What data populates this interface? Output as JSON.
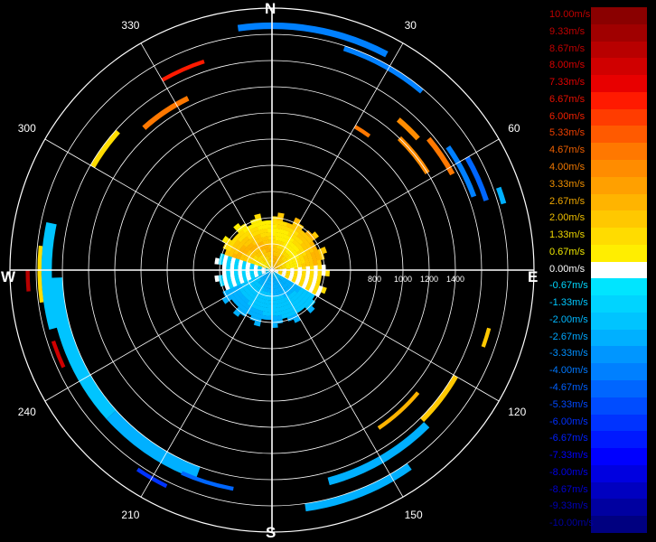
{
  "compass": {
    "north": "N",
    "east": "E",
    "south": "S",
    "west": "W"
  },
  "colors": {
    "background": "#000000",
    "grid": "#ffffff",
    "zero": "#ffffff"
  },
  "chart_data": {
    "type": "polar-radar",
    "angle_tick_labels": [
      {
        "angle": 30,
        "label": "30"
      },
      {
        "angle": 60,
        "label": "60"
      },
      {
        "angle": 120,
        "label": "120"
      },
      {
        "angle": 150,
        "label": "150"
      },
      {
        "angle": 210,
        "label": "210"
      },
      {
        "angle": 240,
        "label": "240"
      },
      {
        "angle": 300,
        "label": "300"
      },
      {
        "angle": 330,
        "label": "330"
      }
    ],
    "range_tick_labels": [
      {
        "value": 800,
        "label": "800"
      },
      {
        "value": 1000,
        "label": "1000"
      },
      {
        "value": 1200,
        "label": "1200"
      },
      {
        "value": 1400,
        "label": "1400"
      }
    ],
    "range_rings": [
      200,
      400,
      600,
      800,
      1000,
      1200,
      1400,
      1600,
      1800,
      2000
    ],
    "range_max": 2000,
    "legend_labels": [
      "10.00m/s",
      "9.33m/s",
      "8.67m/s",
      "8.00m/s",
      "7.33m/s",
      "6.67m/s",
      "6.00m/s",
      "5.33m/s",
      "4.67m/s",
      "4.00m/s",
      "3.33m/s",
      "2.67m/s",
      "2.00m/s",
      "1.33m/s",
      "0.67m/s",
      "0.00m/s",
      "-0.67m/s",
      "-1.33m/s",
      "-2.00m/s",
      "-2.67m/s",
      "-3.33m/s",
      "-4.00m/s",
      "-4.67m/s",
      "-5.33m/s",
      "-6.00m/s",
      "-6.67m/s",
      "-7.33m/s",
      "-8.00m/s",
      "-8.67m/s",
      "-9.33m/s",
      "-10.00m/s"
    ],
    "legend_colors": [
      "#8a0000",
      "#a00000",
      "#b80000",
      "#d00000",
      "#e80000",
      "#ff1a00",
      "#ff3c00",
      "#ff5a00",
      "#ff7800",
      "#ff8c00",
      "#ffa000",
      "#ffb400",
      "#ffc800",
      "#ffdc00",
      "#ffee00",
      "#ffffff",
      "#00e5ff",
      "#00d4ff",
      "#00c4ff",
      "#00b0ff",
      "#0096ff",
      "#0080ff",
      "#0066ff",
      "#004cff",
      "#0033ff",
      "#0019ff",
      "#0000ff",
      "#0000e0",
      "#0000c0",
      "#0000a0",
      "#000080"
    ],
    "legend_text_colors": [
      "#c00000",
      "#c00000",
      "#c00000",
      "#d80000",
      "#e00000",
      "#e81000",
      "#f02000",
      "#f04000",
      "#f06000",
      "#f07800",
      "#f09000",
      "#f0a800",
      "#f0c000",
      "#f0d800",
      "#f0e800",
      "#ffffff",
      "#00d8ff",
      "#00c8ff",
      "#00b8ff",
      "#00a8ff",
      "#0090ff",
      "#0078ff",
      "#0060ff",
      "#0048ff",
      "#0030ff",
      "#0020ff",
      "#0000ff",
      "#0000e8",
      "#0000d0",
      "#0000b8",
      "#0000a0"
    ],
    "inner_field": {
      "range_extent": 430,
      "north_half": "approaching-positive",
      "south_half": "receding-negative"
    },
    "arcs": [
      {
        "az0": 352,
        "az1": 28,
        "r0": 1840,
        "r1": 1890,
        "v": -4.0
      },
      {
        "az0": 18,
        "az1": 40,
        "r0": 1760,
        "r1": 1800,
        "v": -4.0
      },
      {
        "az0": 40,
        "az1": 48,
        "r0": 1480,
        "r1": 1520,
        "v": 4.0
      },
      {
        "az0": 50,
        "az1": 62,
        "r0": 1540,
        "r1": 1580,
        "v": 4.67
      },
      {
        "az0": 55,
        "az1": 70,
        "r0": 1620,
        "r1": 1660,
        "v": -4.0
      },
      {
        "az0": 60,
        "az1": 72,
        "r0": 1700,
        "r1": 1740,
        "v": -4.67
      },
      {
        "az0": 44,
        "az1": 58,
        "r0": 1380,
        "r1": 1420,
        "v": 4.0
      },
      {
        "az0": 120,
        "az1": 135,
        "r0": 1600,
        "r1": 1640,
        "v": 2.0
      },
      {
        "az0": 135,
        "az1": 165,
        "r0": 1640,
        "r1": 1700,
        "v": -2.67
      },
      {
        "az0": 145,
        "az1": 172,
        "r0": 1800,
        "r1": 1860,
        "v": -2.67
      },
      {
        "az0": 200,
        "az1": 228,
        "r0": 1600,
        "r1": 1700,
        "v": -2.67
      },
      {
        "az0": 228,
        "az1": 268,
        "r0": 1600,
        "r1": 1700,
        "v": -2.0
      },
      {
        "az0": 255,
        "az1": 282,
        "r0": 1680,
        "r1": 1760,
        "v": -2.0
      },
      {
        "az0": 262,
        "az1": 276,
        "r0": 1760,
        "r1": 1790,
        "v": 1.33
      },
      {
        "az0": 300,
        "az1": 312,
        "r0": 1560,
        "r1": 1600,
        "v": 1.33
      },
      {
        "az0": 318,
        "az1": 334,
        "r0": 1440,
        "r1": 1480,
        "v": 4.67
      },
      {
        "az0": 330,
        "az1": 342,
        "r0": 1660,
        "r1": 1690,
        "v": 6.67
      },
      {
        "az0": 30,
        "az1": 36,
        "r0": 1250,
        "r1": 1280,
        "v": 4.67
      },
      {
        "az0": 130,
        "az1": 146,
        "r0": 1440,
        "r1": 1470,
        "v": 2.67
      },
      {
        "az0": 190,
        "az1": 204,
        "r0": 1680,
        "r1": 1710,
        "v": -4.67
      },
      {
        "az0": 206,
        "az1": 214,
        "r0": 1820,
        "r1": 1850,
        "v": -6.0
      },
      {
        "az0": 245,
        "az1": 252,
        "r0": 1740,
        "r1": 1770,
        "v": 8.0
      },
      {
        "az0": 265,
        "az1": 270,
        "r0": 1850,
        "r1": 1880,
        "v": 8.67
      },
      {
        "az0": 105,
        "az1": 110,
        "r0": 1700,
        "r1": 1730,
        "v": 2.0
      },
      {
        "az0": 70,
        "az1": 74,
        "r0": 1820,
        "r1": 1860,
        "v": -2.67
      }
    ]
  }
}
